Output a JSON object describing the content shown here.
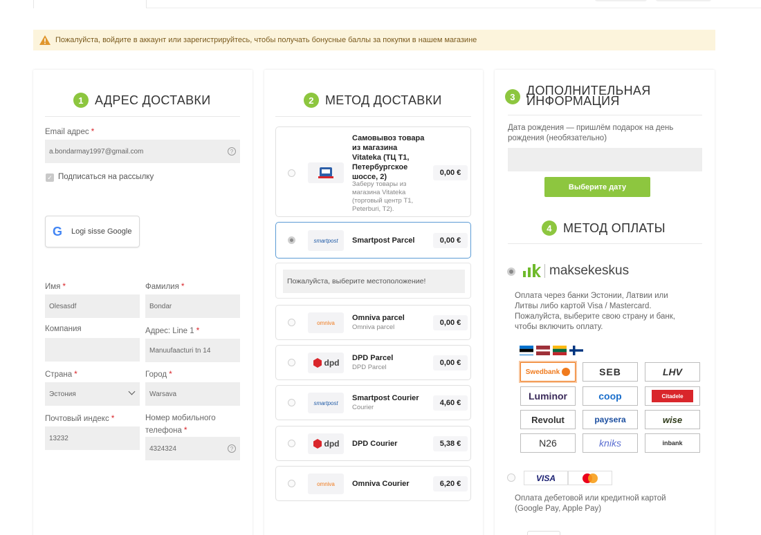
{
  "alert": {
    "text": "Пожалуйста, войдите в аккаунт или зарегистрируйтесь, чтобы получать бонусные баллы за покупки в нашем магазине"
  },
  "colors": {
    "accent": "#8dc63f",
    "required": "#d9262b",
    "alert_bg": "#fcf4dc",
    "selected_border": "#5b9bd5",
    "swedbank_orange": "#f07b1e"
  },
  "address": {
    "number": "1",
    "title": "АДРЕС ДОСТАВКИ",
    "email_label": "Email адрес",
    "email_value": "a.bondarmay1997@gmail.com",
    "newsletter_label": "Подписаться на рассылку",
    "google_label": "Logi sisse Google",
    "first_name_label": "Имя",
    "first_name_value": "Olesasdf",
    "last_name_label": "Фамилия",
    "last_name_value": "Bondar",
    "company_label": "Компания",
    "company_value": "",
    "address_label": "Адрес: Line 1",
    "address_value": "Manuufaacturi tn 14",
    "country_label": "Страна",
    "country_value": "Эстония",
    "city_label": "Город",
    "city_value": "Warsava",
    "zip_label": "Почтовый индекс",
    "zip_value": "13232",
    "phone_label_1": "Номер мобильного",
    "phone_label_2": "телефона",
    "phone_value": "4324324",
    "req": "*",
    "q": "?"
  },
  "shipping": {
    "number": "2",
    "title": "МЕТОД ДОСТАВКИ",
    "location_prompt": "Пожалуйста, выберите местоположение!",
    "options": [
      {
        "name_lines": [
          "Самовывоз товара",
          "из магазина",
          "Vitateka (ТЦ T1,",
          "Петербургское",
          "шоссе, 2)"
        ],
        "sub_lines": [
          "Заберу товары из",
          "магазина Vitateka",
          "(торговый центр T1,",
          "Peterburi, T2)."
        ],
        "price": "0,00 €",
        "logo": "vitateka"
      },
      {
        "name": "Smartpost Parcel",
        "price": "0,00 €",
        "logo": "smartpost",
        "logo_text": "smartpost"
      },
      {
        "name": "Omniva parcel",
        "sub": "Omniva parcel",
        "price": "0,00 €",
        "logo": "omniva",
        "logo_text": "omniva"
      },
      {
        "name": "DPD Parcel",
        "sub": "DPD Parcel",
        "price": "0,00 €",
        "logo": "dpd",
        "logo_text": "dpd"
      },
      {
        "name": "Smartpost Courier",
        "sub": "Courier",
        "price": "4,60 €",
        "logo": "smartpost",
        "logo_text": "smartpost"
      },
      {
        "name": "DPD Courier",
        "price": "5,38 €",
        "logo": "dpd",
        "logo_text": "dpd"
      },
      {
        "name": "Omniva Courier",
        "price": "6,20 €",
        "logo": "omniva",
        "logo_text": "omniva"
      }
    ]
  },
  "extra": {
    "number": "3",
    "title_1": "ДОПОЛНИТЕЛЬНАЯ",
    "title_2": "ИНФОРМАЦИЯ",
    "birth_label_1": "Дата рождения — пришлём подарок на день",
    "birth_label_2": "рождения (необязательно)",
    "date_button": "Выберите дату"
  },
  "payment": {
    "number": "4",
    "title": "МЕТОД ОПЛАТЫ",
    "provider": "maksekeskus",
    "provider_desc": [
      "Оплата через банки Эстонии, Латвии или",
      "Литвы либо картой Visa / Mastercard.",
      "Пожалуйста, выберите свою страну и банк,",
      "чтобы включить оплату."
    ],
    "banks": [
      "Swedbank",
      "SEB",
      "LHV",
      "Luminor",
      "coop",
      "Citadele",
      "Revolut",
      "paysera",
      "wise",
      "N26",
      "kniks",
      "inbank"
    ],
    "card_label": "VISA",
    "card_desc": [
      "Оплата дебетовой или кредитной картой",
      "(Google Pay, Apple Pay)"
    ]
  }
}
